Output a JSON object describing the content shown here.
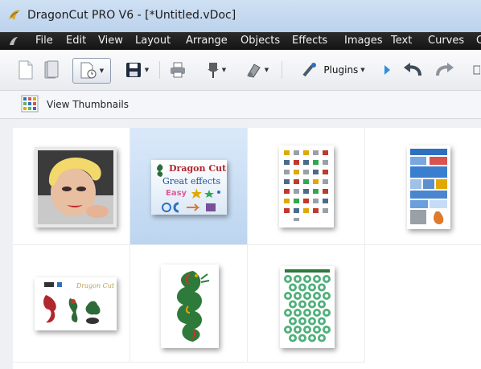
{
  "window": {
    "title": "DragonCut PRO V6 - [*Untitled.vDoc]"
  },
  "menu": {
    "items": [
      "File",
      "Edit",
      "View",
      "Layout",
      "Arrange",
      "Objects",
      "Effects",
      "Images",
      "Text",
      "Curves",
      "C"
    ]
  },
  "toolbar": {
    "plugins_label": "Plugins",
    "buttons": [
      "new-document",
      "open-document",
      "page-setup",
      "save",
      "print",
      "pin-tool",
      "eraser-tool",
      "plugins",
      "run",
      "undo",
      "redo"
    ]
  },
  "viewbar": {
    "label": "View Thumbnails"
  },
  "gallery": {
    "selected_index": 1,
    "thumbnails": [
      {
        "name": "portrait-photo"
      },
      {
        "name": "dragon-cut-effects"
      },
      {
        "name": "icon-sheet"
      },
      {
        "name": "collage-poster"
      },
      {
        "name": "dragon-stickers"
      },
      {
        "name": "green-dragon"
      },
      {
        "name": "circle-pattern"
      }
    ],
    "effects_card": {
      "line1": "Dragon Cut",
      "line2": "Great effects",
      "line3": "Easy"
    },
    "sticker_card": {
      "text": "Dragon Cut"
    }
  },
  "colors": {
    "menubar": "#1c1c1c",
    "selection": "#c6dcf4",
    "accent_blue": "#2f6fc0"
  }
}
